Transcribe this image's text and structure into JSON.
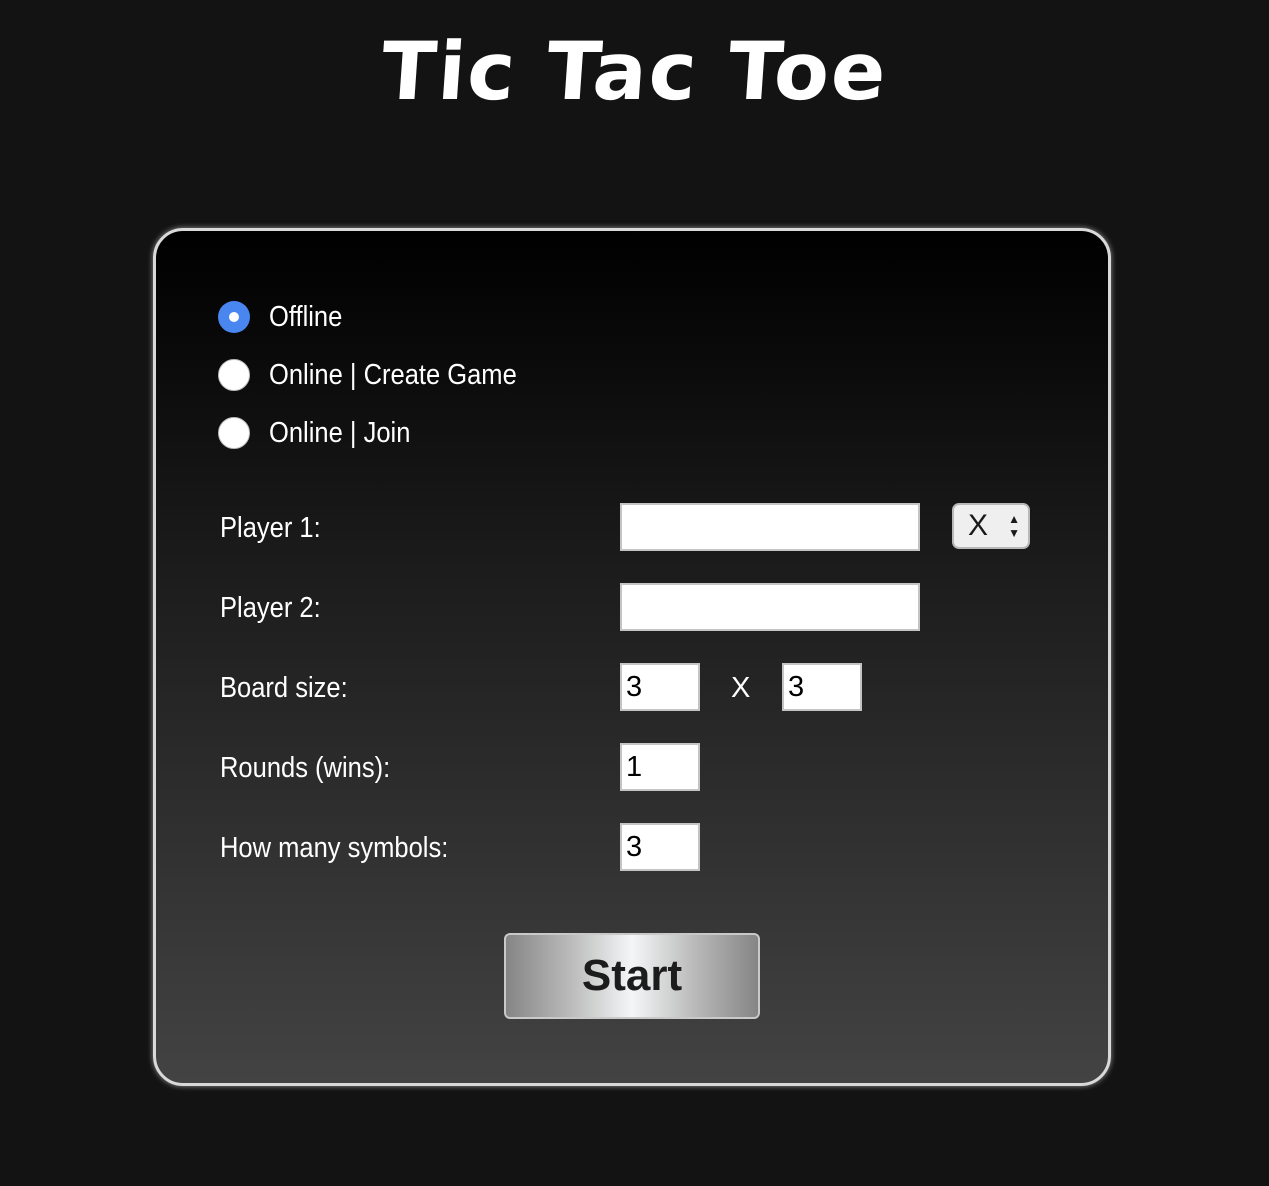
{
  "app": {
    "title": "Tic Tac Toe"
  },
  "mode": {
    "options": [
      {
        "label": "Offline",
        "checked": true
      },
      {
        "label": "Online | Create Game",
        "checked": false
      },
      {
        "label": "Online | Join",
        "checked": false
      }
    ]
  },
  "form": {
    "player1": {
      "label": "Player 1:",
      "value": ""
    },
    "player1_symbol": {
      "value": "X"
    },
    "player2": {
      "label": "Player 2:",
      "value": ""
    },
    "board_size": {
      "label": "Board size:",
      "rows": "3",
      "separator": "X",
      "cols": "3"
    },
    "rounds": {
      "label": "Rounds (wins):",
      "value": "1"
    },
    "symbols": {
      "label": "How many symbols:",
      "value": "3"
    }
  },
  "actions": {
    "start_label": "Start"
  },
  "colors": {
    "background": "#131313",
    "radio_accent": "#4a86f0",
    "panel_border": "#d9d9d9"
  }
}
